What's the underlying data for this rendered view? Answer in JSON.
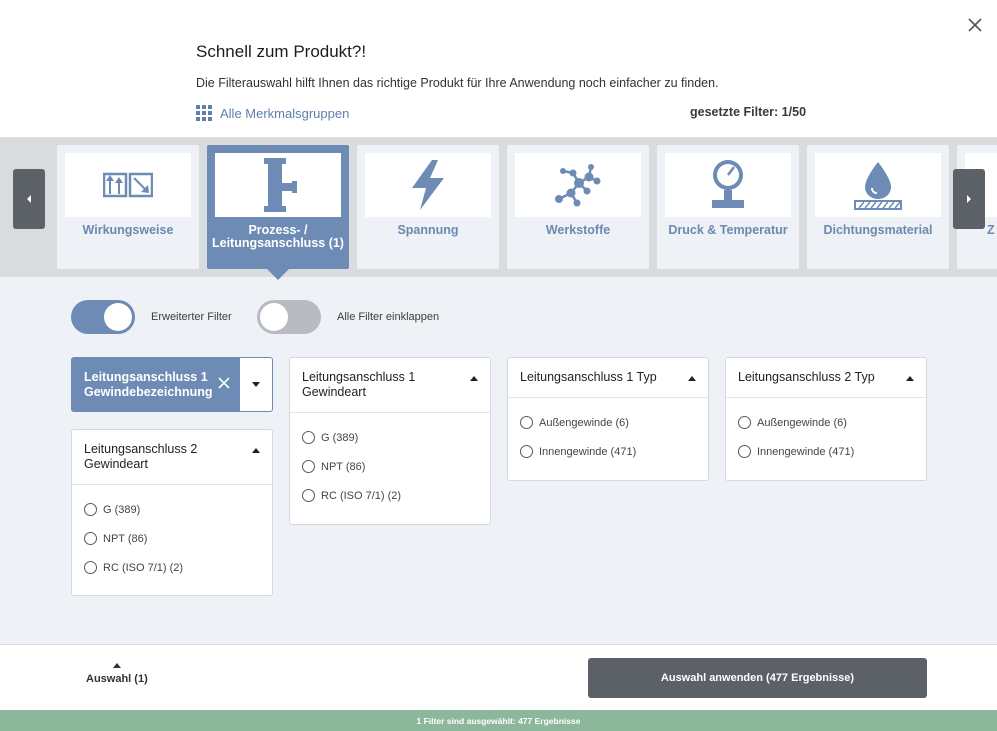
{
  "header": {
    "title": "Schnell zum Produkt?!",
    "subtitle": "Die Filterauswahl hilft Ihnen das richtige Produkt für Ihre Anwendung noch einfacher zu finden.",
    "all_groups_label": "Alle Merkmalsgruppen",
    "filters_set": "gesetzte Filter: 1/50"
  },
  "categories": [
    {
      "label": "Wirkungsweise",
      "icon": "flow-arrows-icon",
      "active": false
    },
    {
      "label": "Prozess- / Leitungsanschluss (1)",
      "icon": "pipe-connection-icon",
      "active": true
    },
    {
      "label": "Spannung",
      "icon": "lightning-icon",
      "active": false
    },
    {
      "label": "Werkstoffe",
      "icon": "molecule-icon",
      "active": false
    },
    {
      "label": "Druck & Temperatur",
      "icon": "pressure-gauge-icon",
      "active": false
    },
    {
      "label": "Dichtungsmaterial",
      "icon": "seal-drop-icon",
      "active": false
    },
    {
      "label": "Z",
      "icon": "",
      "active": false
    }
  ],
  "toggles": {
    "extended": {
      "label": "Erweiterter Filter",
      "on": true
    },
    "collapse": {
      "label": "Alle Filter einklappen",
      "on": false
    }
  },
  "selected_filter": {
    "label_line1": "Leitungsanschluss 1",
    "label_line2": "Gewindebezeichnung"
  },
  "filter_cards": {
    "c1": {
      "title_line1": "Leitungsanschluss 2",
      "title_line2": "Gewindeart",
      "options": [
        "G (389)",
        "NPT (86)",
        "RC (ISO 7/1) (2)"
      ]
    },
    "c2": {
      "title_line1": "Leitungsanschluss 1",
      "title_line2": "Gewindeart",
      "options": [
        "G (389)",
        "NPT (86)",
        "RC (ISO 7/1) (2)"
      ]
    },
    "c3": {
      "title_line1": "Leitungsanschluss 1 Typ",
      "options": [
        "Außengewinde (6)",
        "Innengewinde (471)"
      ]
    },
    "c4": {
      "title_line1": "Leitungsanschluss 2 Typ",
      "options": [
        "Außengewinde (6)",
        "Innengewinde (471)"
      ]
    }
  },
  "footer": {
    "selection_label": "Auswahl (1)",
    "apply_label": "Auswahl anwenden (477 Ergebnisse)",
    "status": "1 Filter sind ausgewählt: 477 Ergebnisse"
  },
  "colors": {
    "accent": "#6d8bb5",
    "button_dark": "#5b6166",
    "status_green": "#8db79a",
    "link": "#5f80ab"
  }
}
